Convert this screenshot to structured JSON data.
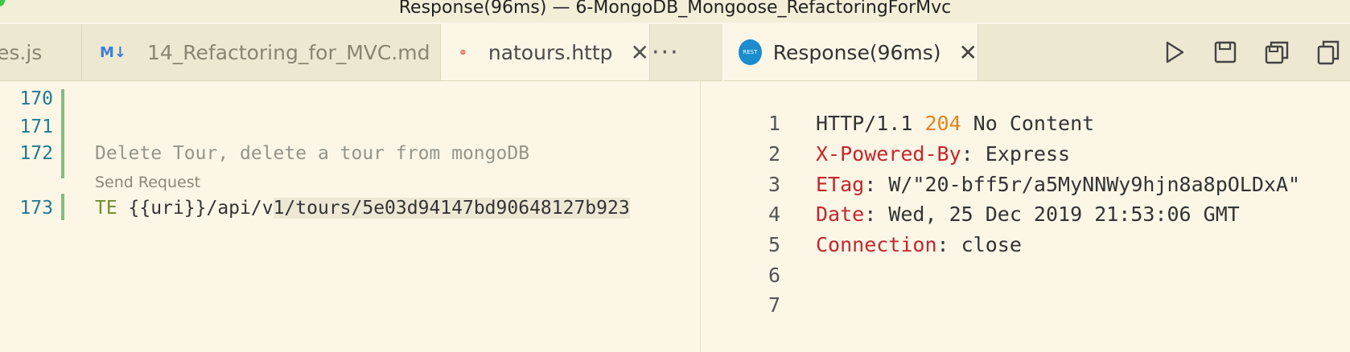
{
  "window": {
    "title": "Response(96ms) — 6-MongoDB_Mongoose_RefactoringForMvc"
  },
  "left_tabs": {
    "tab1_label": "es.js",
    "tab2_label": "14_Refactoring_for_MVC.md",
    "tab2_icon": "M↓",
    "tab3_label": "natours.http",
    "close_glyph": "✕",
    "more_glyph": "···"
  },
  "right_tabs": {
    "tab_label": "Response(96ms)",
    "icon_text": "REST",
    "close_glyph": "✕"
  },
  "editor": {
    "lines": [
      {
        "num": "170",
        "text": ""
      },
      {
        "num": "171",
        "text": ""
      },
      {
        "num": "172",
        "text": "Delete Tour, delete a tour from mongoDB"
      },
      {
        "num": "173",
        "method": "TE",
        "url_pre": " {{uri}}/api/v",
        "url_hl": "1/tours/5e03d94147bd90648127b923"
      }
    ],
    "codelens": "Send Request"
  },
  "response": {
    "lines": [
      {
        "num": "1",
        "pre": "HTTP/1.1 ",
        "status": "204",
        "post": " No Content"
      },
      {
        "num": "2",
        "name": "X-Powered-By",
        "value": ": Express"
      },
      {
        "num": "3",
        "name": "ETag",
        "value": ": W/\"20-bff5r/a5MyNNWy9hjn8a8pOLDxA\""
      },
      {
        "num": "4",
        "name": "Date",
        "value": ": Wed, 25 Dec 2019 21:53:06 GMT"
      },
      {
        "num": "5",
        "name": "Connection",
        "value": ": close"
      },
      {
        "num": "6"
      },
      {
        "num": "7"
      }
    ]
  },
  "colors": {
    "background": "#fbf6e6",
    "header_name": "#c4262e",
    "status_code": "#e4831d",
    "line_number": "#237893"
  }
}
